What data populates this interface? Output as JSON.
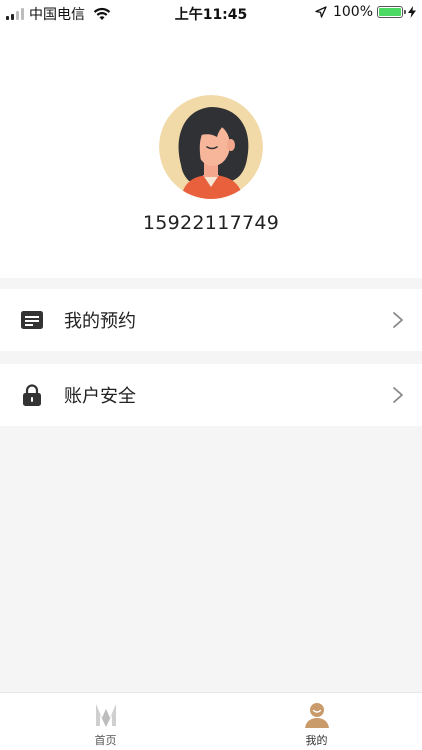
{
  "status_bar": {
    "carrier": "中国电信",
    "time": "上午11:45",
    "battery_percent": "100%",
    "battery_level": 1.0
  },
  "profile": {
    "phone_number": "15922117749",
    "avatar_icon": "avatar-woman-icon"
  },
  "menu": [
    {
      "label": "我的预约",
      "icon": "document-list-icon"
    },
    {
      "label": "账户安全",
      "icon": "lock-icon"
    }
  ],
  "tab_bar": {
    "tabs": [
      {
        "label": "首页",
        "icon": "home-logo-icon",
        "active": false
      },
      {
        "label": "我的",
        "icon": "person-icon",
        "active": true
      }
    ]
  },
  "colors": {
    "page_background": "#f5f5f5",
    "avatar_background": "#f2d9a8",
    "accent_tan": "#c99a6a",
    "battery_green": "#4cd964"
  }
}
